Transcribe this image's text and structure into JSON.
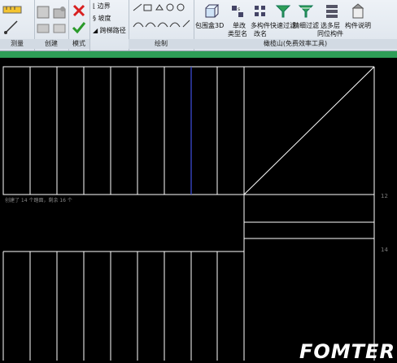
{
  "ribbon": {
    "panels": {
      "measure": "测量",
      "create": "创建",
      "mode": "模式",
      "draw": "绘制",
      "addon": "橄榄山(免费效率工具)"
    },
    "mode_items": {
      "boundary": "边界",
      "slope": "坡度",
      "span": "跨梯路径"
    },
    "tools": {
      "box3d": "包围盒3D",
      "single_type": "单改",
      "single_type_2": "类型名",
      "multi_rename": "多构件",
      "multi_rename_2": "改名",
      "quick_filter": "快速过滤",
      "fine_filter": "精细过滤",
      "multi_layer": "选多层",
      "multi_layer_2": "同位构件",
      "member_note": "构件说明"
    }
  },
  "canvas": {
    "status_text": "创建了 14 个踏面，剩余 16 个",
    "level_12": "12",
    "level_14": "14"
  },
  "watermark": "FOMTER",
  "colors": {
    "highlight_line": "#3b4bd1",
    "ribbon_accent": "#2e9e57"
  }
}
